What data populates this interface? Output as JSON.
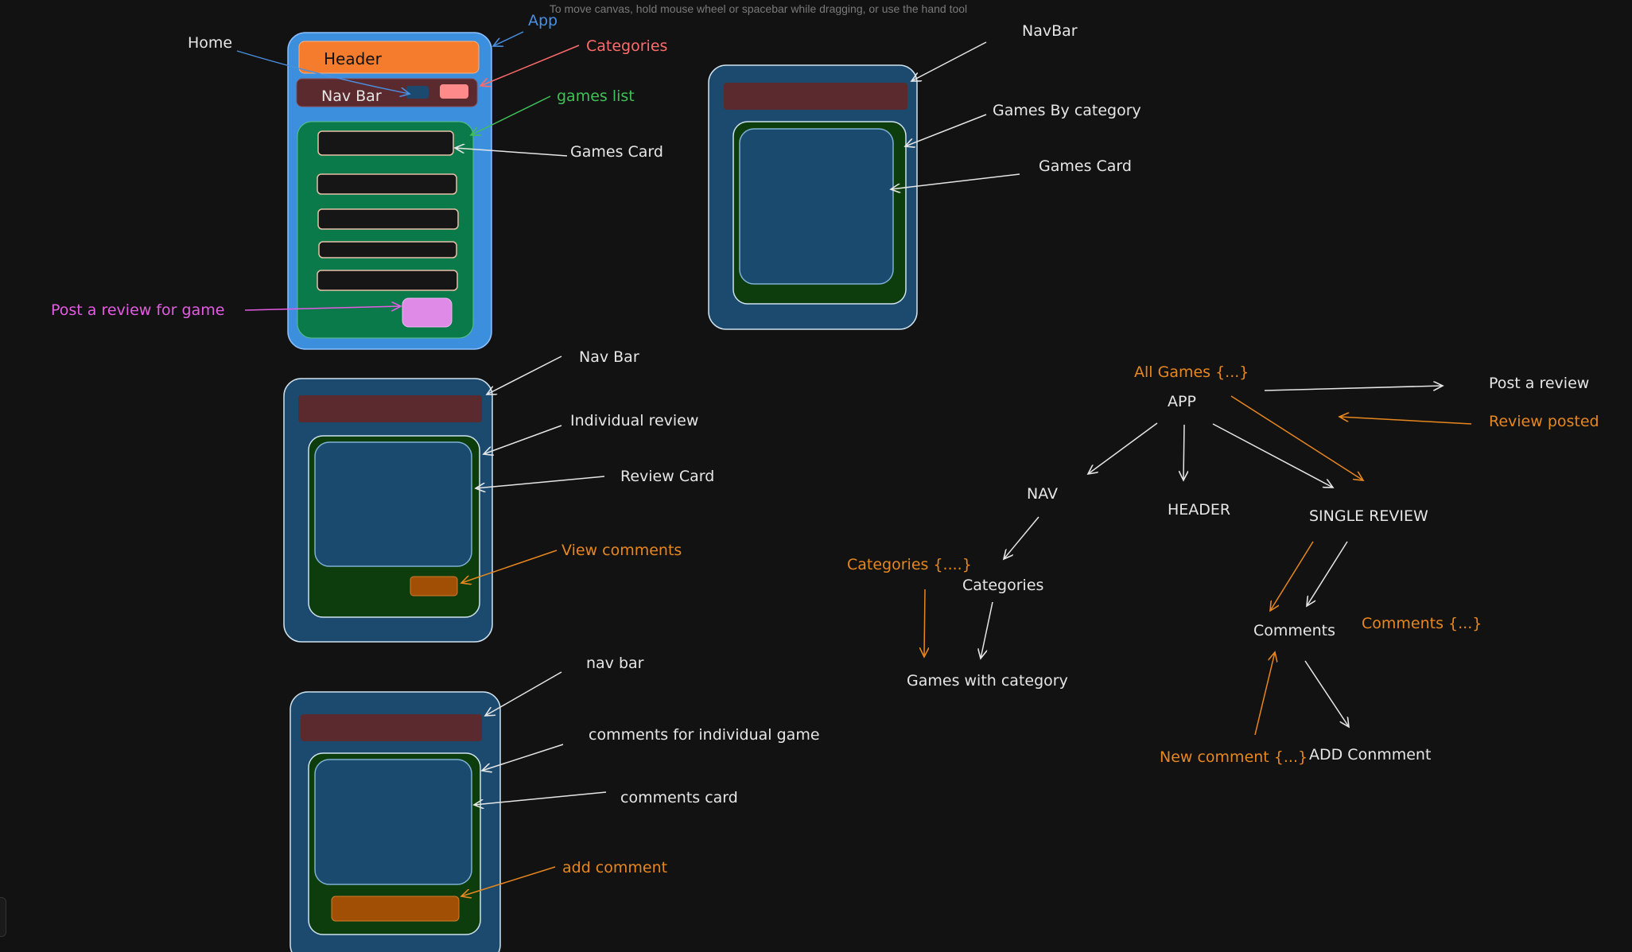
{
  "hint": "To move canvas, hold mouse wheel or spacebar while dragging, or use the hand tool",
  "colors": {
    "white": "#e6e6e6",
    "orange": "#e8871e",
    "blue": "#4a90e2",
    "salmon": "#ff6b6b",
    "green": "#40c057",
    "violet": "#e35ce3",
    "panel_blue": "#1c4a6e",
    "panel_dark_green": "#0d3d0d",
    "card_blue": "#1b4a6f",
    "nav_maroon": "#5a2a2e",
    "header_orange": "#f57c2c",
    "app_blue": "#3b8fdd",
    "list_green": "#0b7a4a",
    "review_btn": "#e08ae8",
    "comment_btn": "#a14f05"
  },
  "home": {
    "header": "Header",
    "nav_bar": "Nav Bar",
    "labels": {
      "app": "App",
      "home": "Home",
      "categories": "Categories",
      "games_list": "games list",
      "games_card": "Games Card",
      "post_review": "Post a review for game"
    }
  },
  "category_page": {
    "labels": {
      "navbar": "NavBar",
      "games_by_category": "Games By category",
      "games_card": "Games Card"
    }
  },
  "review_page": {
    "labels": {
      "nav_bar": "Nav Bar",
      "individual_review": "Individual review",
      "review_card": "Review Card",
      "view_comments": "View comments"
    }
  },
  "comments_page": {
    "labels": {
      "nav_bar": "nav bar",
      "comments_for_game": "comments for individual game",
      "comments_card": "comments card",
      "add_comment": "add comment"
    }
  },
  "tree": {
    "all_games": "All Games {...}",
    "app": "APP",
    "post_a_review": "Post a review",
    "review_posted": "Review posted",
    "nav": "NAV",
    "header": "HEADER",
    "single_review": "SINGLE REVIEW",
    "categories_state": "Categories {....}",
    "categories": "Categories",
    "games_with_category": "Games with category",
    "comments": "Comments",
    "comments_state": "Comments {...}",
    "new_comment": "New comment {...}",
    "add_comment": "ADD Conmment"
  }
}
